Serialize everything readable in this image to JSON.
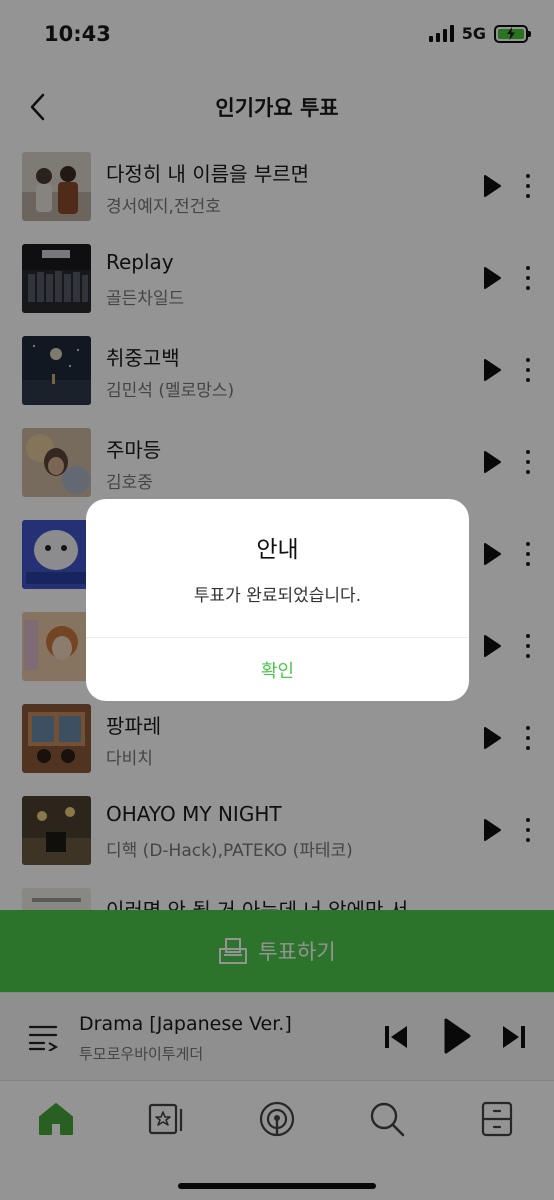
{
  "status_bar": {
    "time": "10:43",
    "network": "5G",
    "battery_icon": "battery-charging-icon"
  },
  "header": {
    "title": "인기가요 투표",
    "back_icon": "chevron-left-icon"
  },
  "songs": [
    {
      "title": "다정히 내 이름을 부르면",
      "artist": "경서예지,전건호"
    },
    {
      "title": "Replay",
      "artist": "골든차일드"
    },
    {
      "title": "취중고백",
      "artist": "김민석 (멜로망스)"
    },
    {
      "title": "주마등",
      "artist": "김호중"
    },
    {
      "title": "",
      "artist": ""
    },
    {
      "title": "",
      "artist": ""
    },
    {
      "title": "팡파레",
      "artist": "다비치"
    },
    {
      "title": "OHAYO MY NIGHT",
      "artist": "디핵 (D-Hack),PATEKO (파테코)"
    },
    {
      "title": "이러면 안 될 거 아는데 너 앞에만 서",
      "artist": ""
    }
  ],
  "vote_button": {
    "label": "투표하기"
  },
  "now_playing": {
    "title": "Drama [Japanese Ver.]",
    "artist": "투모로우바이투게더"
  },
  "tabs": [
    {
      "name": "home",
      "icon": "home-icon",
      "active": true
    },
    {
      "name": "library",
      "icon": "star-card-icon",
      "active": false
    },
    {
      "name": "podcast",
      "icon": "podcast-icon",
      "active": false
    },
    {
      "name": "search",
      "icon": "search-icon",
      "active": false
    },
    {
      "name": "storage",
      "icon": "drawer-icon",
      "active": false
    }
  ],
  "dialog": {
    "title": "안내",
    "message": "투표가 완료되었습니다.",
    "confirm_label": "확인"
  },
  "colors": {
    "accent_green": "#4cc64a",
    "dim_overlay": "rgba(0,0,0,0.42)"
  }
}
